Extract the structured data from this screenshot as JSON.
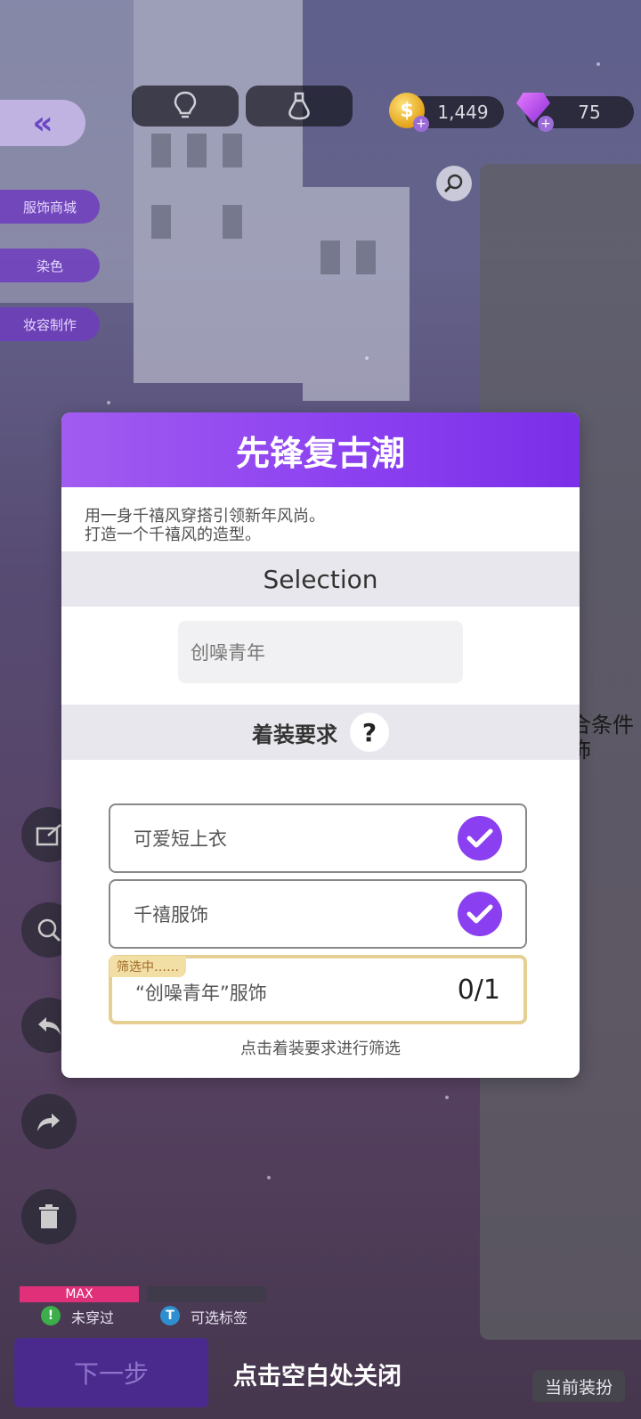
{
  "top_bar": {
    "coins": "1,449",
    "gems": "75",
    "icons": [
      "double-chevron-left-icon",
      "lightbulb-icon",
      "potion-icon",
      "coin-icon",
      "gem-icon",
      "plus-icon"
    ]
  },
  "side_menu": [
    "服饰商城",
    "染色",
    "妆容制作"
  ],
  "right_panel": {
    "text_line1": "合条件",
    "text_line2": "饰"
  },
  "modal": {
    "title": "先锋复古潮",
    "description_line1": "用一身千禧风穿搭引领新年风尚。",
    "description_line2": "打造一个千禧风的造型。",
    "selection_header": "Selection",
    "selection_value": "创噪青年",
    "requirements_header": "着装要求",
    "help_symbol": "?",
    "requirements": [
      {
        "label": "可爱短上衣",
        "done": true
      },
      {
        "label": "千禧服饰",
        "done": true
      },
      {
        "label": "“创噪青年”服饰",
        "progress": "0/1",
        "filter_tag": "筛选中……"
      }
    ],
    "hint": "点击着装要求进行筛选"
  },
  "bottom": {
    "max_label": "MAX",
    "status_not_worn": "未穿过",
    "status_tags": "可选标签",
    "next_button": "下一步",
    "close_hint": "点击空白处关闭",
    "current_outfit": "当前装扮"
  },
  "colors": {
    "accent": "#8a3ff0",
    "filter_border": "#e5cf92",
    "max_bar": "#e0307a"
  }
}
